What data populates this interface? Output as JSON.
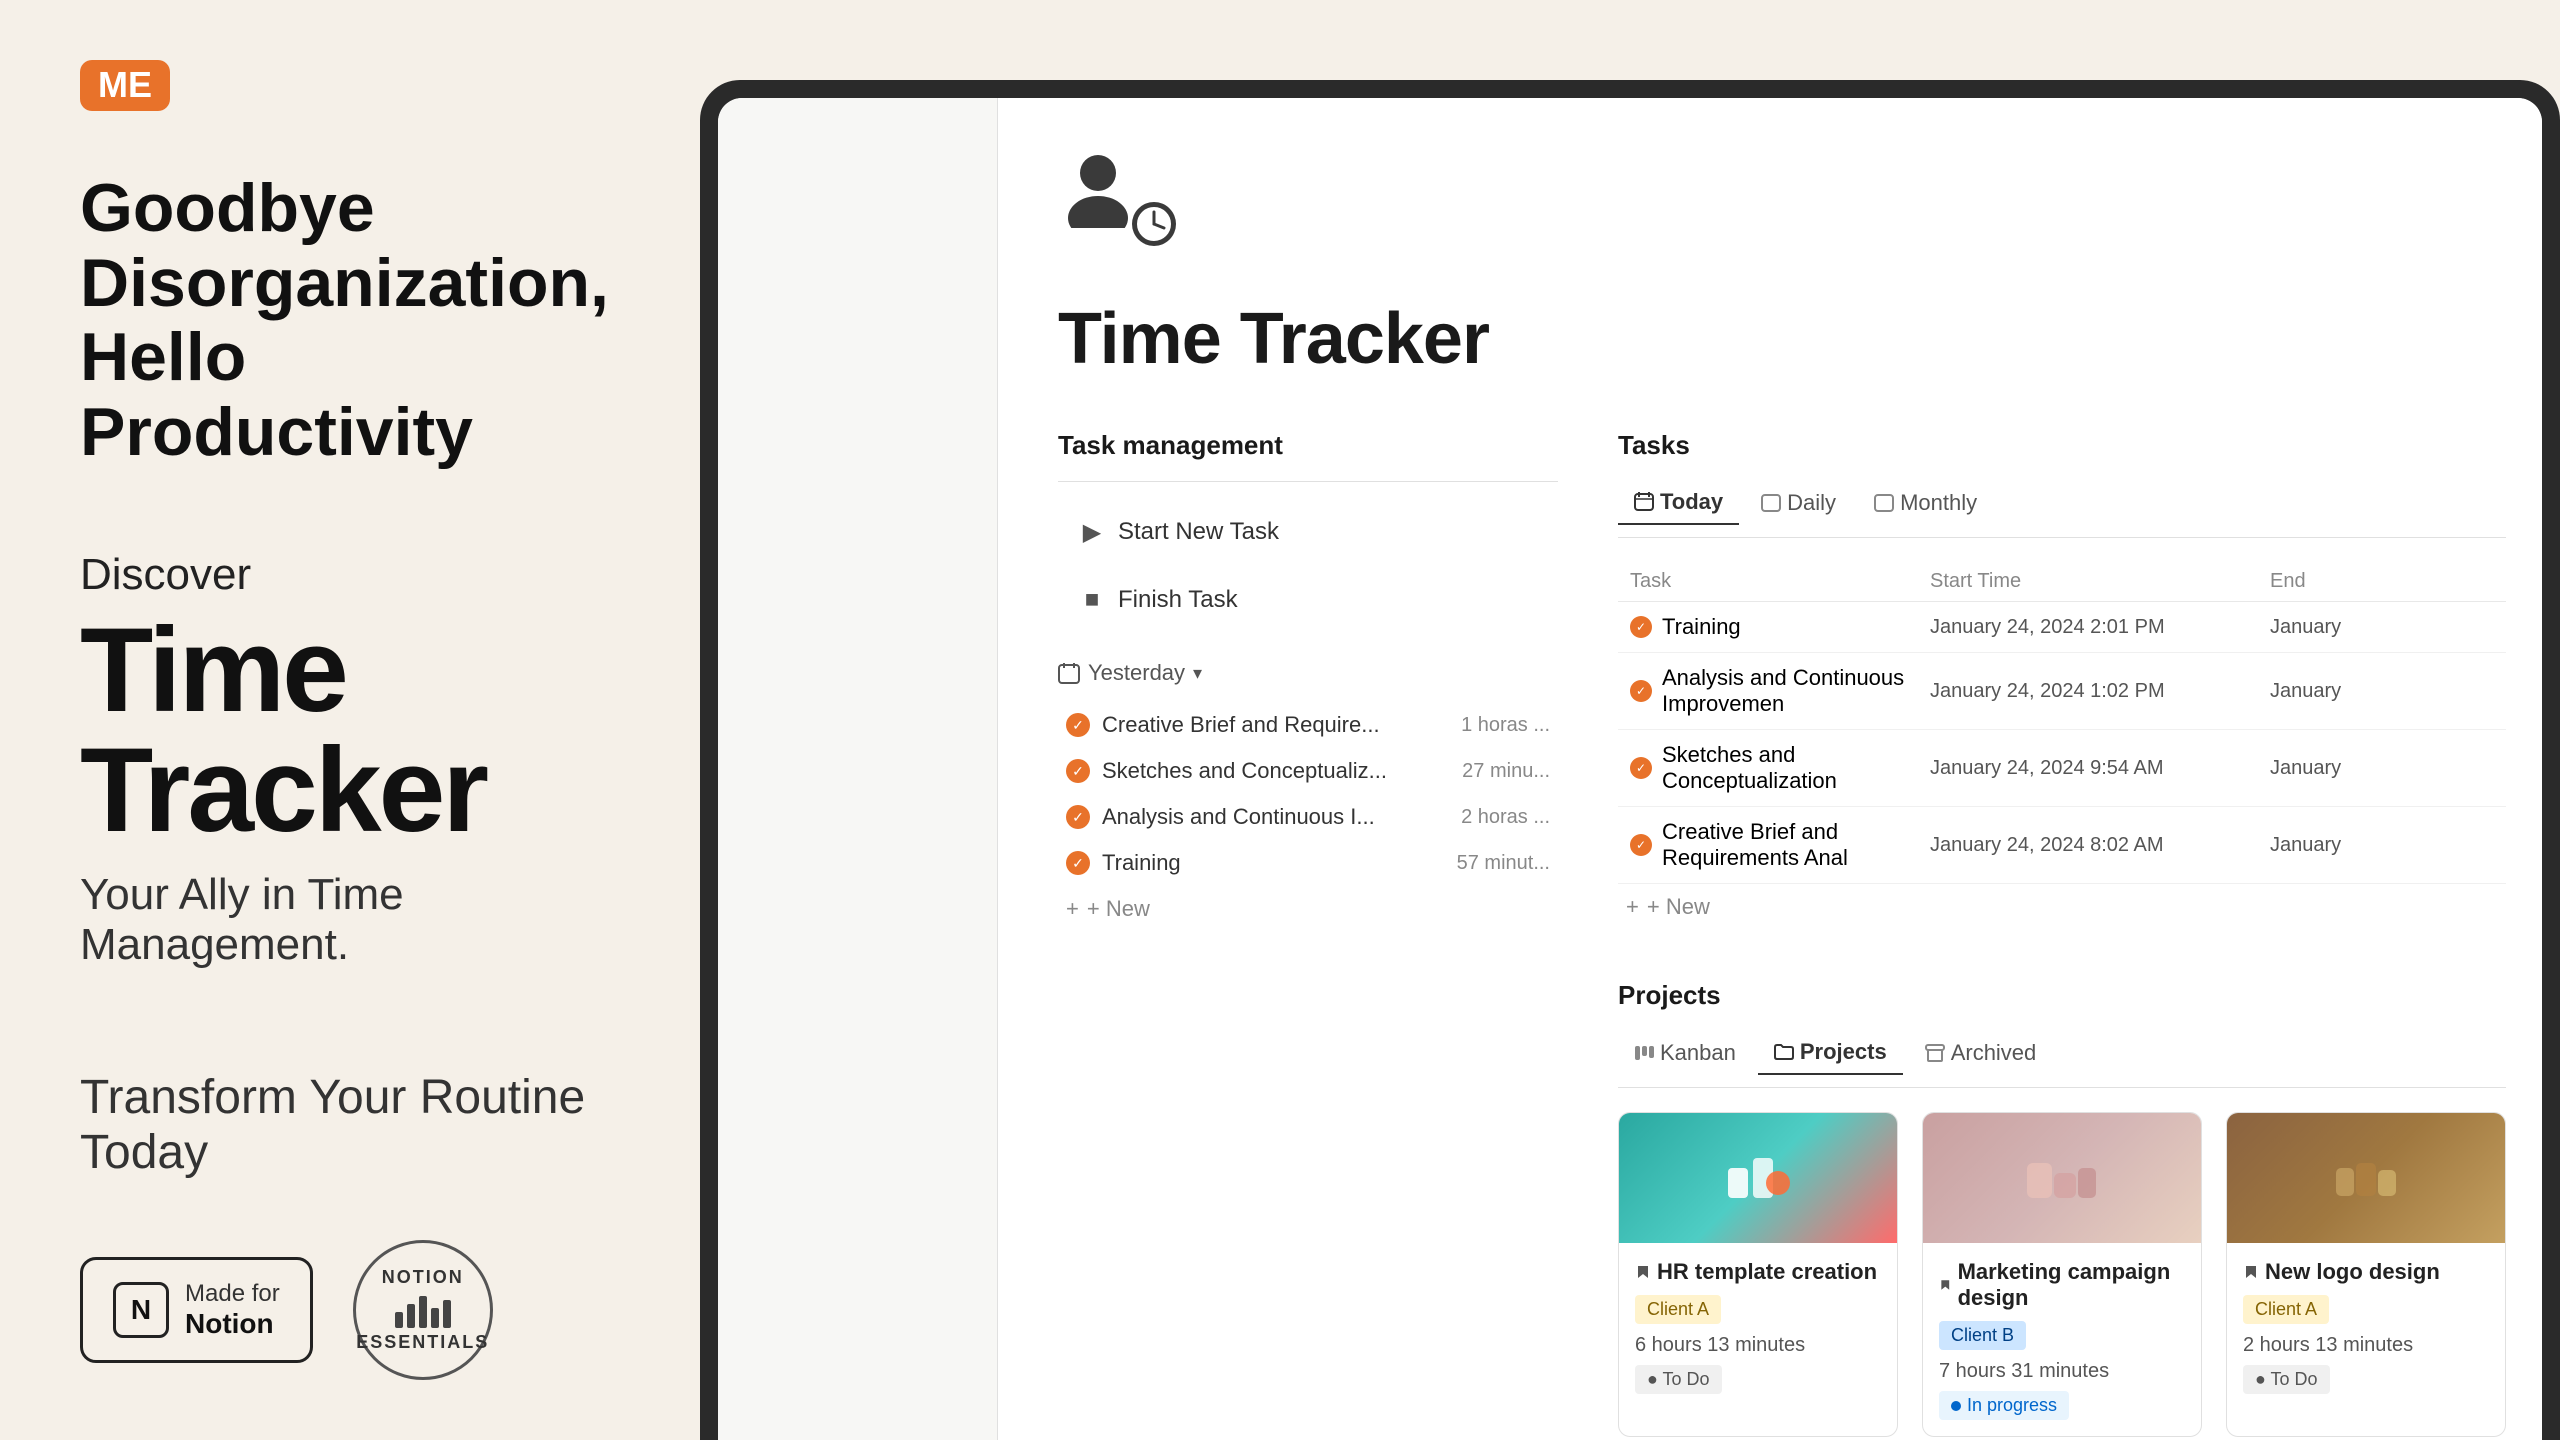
{
  "logo": {
    "text": "ME",
    "bg_color": "#e8722a"
  },
  "left": {
    "headline_line1": "Goodbye Disorganization,",
    "headline_line2": "Hello Productivity",
    "discover": "Discover",
    "product_name": "Time Tracker",
    "tagline": "Your Ally in Time Management.",
    "transform": "Transform Your Routine Today",
    "badge_made_for": "Made for",
    "badge_notion": "Notion",
    "badge_essentials_top": "NOTION",
    "badge_essentials_bottom": "ESSENTIALS"
  },
  "app": {
    "title": "Time Tracker",
    "task_management_label": "Task management",
    "start_new_task": "Start New Task",
    "finish_task": "Finish Task",
    "yesterday_label": "Yesterday",
    "tasks_label": "Tasks",
    "projects_label": "Projects",
    "new_label": "+ New",
    "yesterday_items": [
      {
        "name": "Creative Brief and Require...",
        "duration": "1 horas ..."
      },
      {
        "name": "Sketches and Conceptualiz...",
        "duration": "27 minu..."
      },
      {
        "name": "Analysis and Continuous I...",
        "duration": "2 horas ..."
      },
      {
        "name": "Training",
        "duration": "57 minut..."
      }
    ],
    "tabs": {
      "today": "Today",
      "daily": "Daily",
      "monthly": "Monthly"
    },
    "table_headers": {
      "task": "Task",
      "start_time": "Start Time",
      "end": "End"
    },
    "table_rows": [
      {
        "name": "Training",
        "start": "January 24, 2024 2:01 PM",
        "end": "January"
      },
      {
        "name": "Analysis and Continuous Improvemen",
        "start": "January 24, 2024 1:02 PM",
        "end": "January"
      },
      {
        "name": "Sketches and Conceptualization",
        "start": "January 24, 2024 9:54 AM",
        "end": "January"
      },
      {
        "name": "Creative Brief and Requirements Anal",
        "start": "January 24, 2024 8:02 AM",
        "end": "January"
      }
    ],
    "new_task_label": "+ New",
    "project_tabs": {
      "kanban": "Kanban",
      "projects": "Projects",
      "archived": "Archived"
    },
    "project_cards": [
      {
        "title": "HR template creation",
        "client": "Client A",
        "client_class": "client-a",
        "hours": "6 hours 13 minutes",
        "status": "To Do",
        "status_class": "status-todo",
        "thumb_class": "teal"
      },
      {
        "title": "Marketing campaign design",
        "client": "Client B",
        "client_class": "client-b",
        "hours": "7 hours 31 minutes",
        "status": "In progress",
        "status_class": "status-inprog",
        "thumb_class": "pink"
      },
      {
        "title": "New logo design",
        "client": "Client A",
        "client_class": "client-a",
        "hours": "2 hours 13 minutes",
        "status": "To Do",
        "status_class": "status-todo",
        "thumb_class": "brown"
      }
    ]
  }
}
